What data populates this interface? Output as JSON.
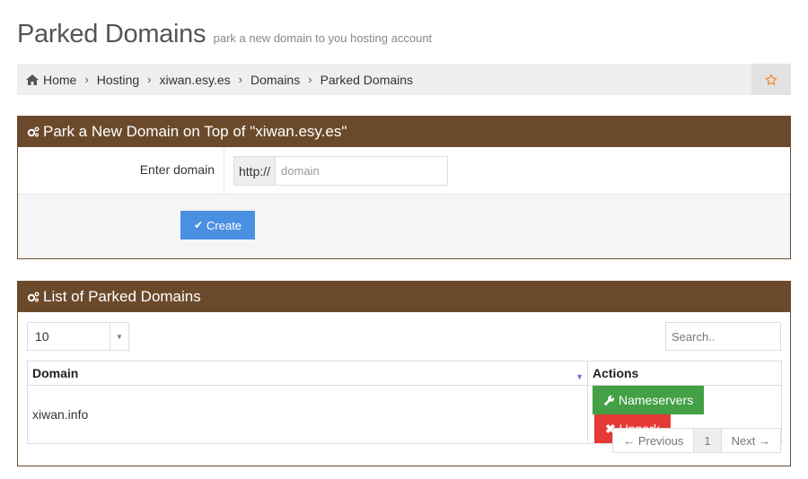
{
  "page": {
    "title": "Parked Domains",
    "subtitle": "park a new domain to you hosting account"
  },
  "breadcrumb": {
    "items": [
      "Home",
      "Hosting",
      "xiwan.esy.es",
      "Domains",
      "Parked Domains"
    ],
    "separator": "›"
  },
  "park_panel": {
    "title": "Park a New Domain on Top of \"xiwan.esy.es\"",
    "label": "Enter domain",
    "prefix": "http://",
    "input_placeholder": "domain",
    "input_value": "",
    "create_label": "Create"
  },
  "list_panel": {
    "title": "List of Parked Domains",
    "page_length": "10",
    "search_placeholder": "Search..",
    "columns": [
      "Domain",
      "Actions"
    ],
    "rows": [
      {
        "domain": "xiwan.info",
        "nameservers_label": "Nameservers",
        "unpark_label": "Unpark"
      }
    ],
    "pagination": {
      "previous": "← Previous",
      "page": "1",
      "next": "Next →"
    }
  },
  "colors": {
    "panel_header": "#6b4a2b",
    "create_button": "#4a90e2",
    "nameservers_button": "#43a047",
    "unpark_button": "#e53935",
    "star_icon": "#f0892e"
  }
}
